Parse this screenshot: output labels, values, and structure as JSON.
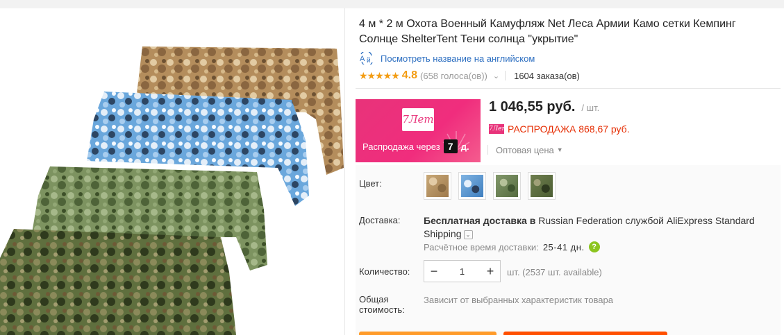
{
  "product": {
    "title": "4 м * 2 м Охота Военный Камуфляж Net Леса Армии Камо сетки Кемпинг Солнце ShelterTent Тени солнца \"укрытие\"",
    "translate_link": "Посмотреть название на английском",
    "rating_stars": "★★★★★",
    "rating_value": "4.8",
    "votes": "(658 голоса(ов))",
    "orders": "1604 заказа(ов)"
  },
  "promo": {
    "logo_text": "7Лет",
    "countdown_prefix": "Распродажа через",
    "countdown_value": "7",
    "countdown_unit": "д."
  },
  "price": {
    "value": "1 046,55 руб.",
    "per_unit": "/ шт.",
    "sale_badge": "7Лет",
    "sale_text": "РАСПРОДАЖА 868,67 руб.",
    "wholesale": "Оптовая цена"
  },
  "options": {
    "color_label": "Цвет:",
    "colors": [
      "desert-camo",
      "blue-camo",
      "green-camo",
      "woodland-camo"
    ],
    "delivery_label": "Доставка:",
    "delivery_bold": "Бесплатная доставка в",
    "delivery_rest": " Russian Federation службой AliExpress Standard Shipping",
    "eta_label": "Расчётное время доставки:",
    "eta_value": "25-41 дн.",
    "qty_label": "Количество:",
    "qty_minus": "−",
    "qty_value": "1",
    "qty_plus": "+",
    "availability": "шт. (2537 шт. available)",
    "total_label_line1": "Общая",
    "total_label_line2": "стоимость:",
    "total_note": "Зависит от выбранных характеристик товара"
  },
  "colors": {
    "accent_pink": "#e8337a",
    "sale_red": "#e62e04",
    "rating_orange": "#f39c12",
    "link_blue": "#2d6fc1",
    "buy_orange": "#ff9b2a",
    "cart_red": "#ff4f00"
  }
}
